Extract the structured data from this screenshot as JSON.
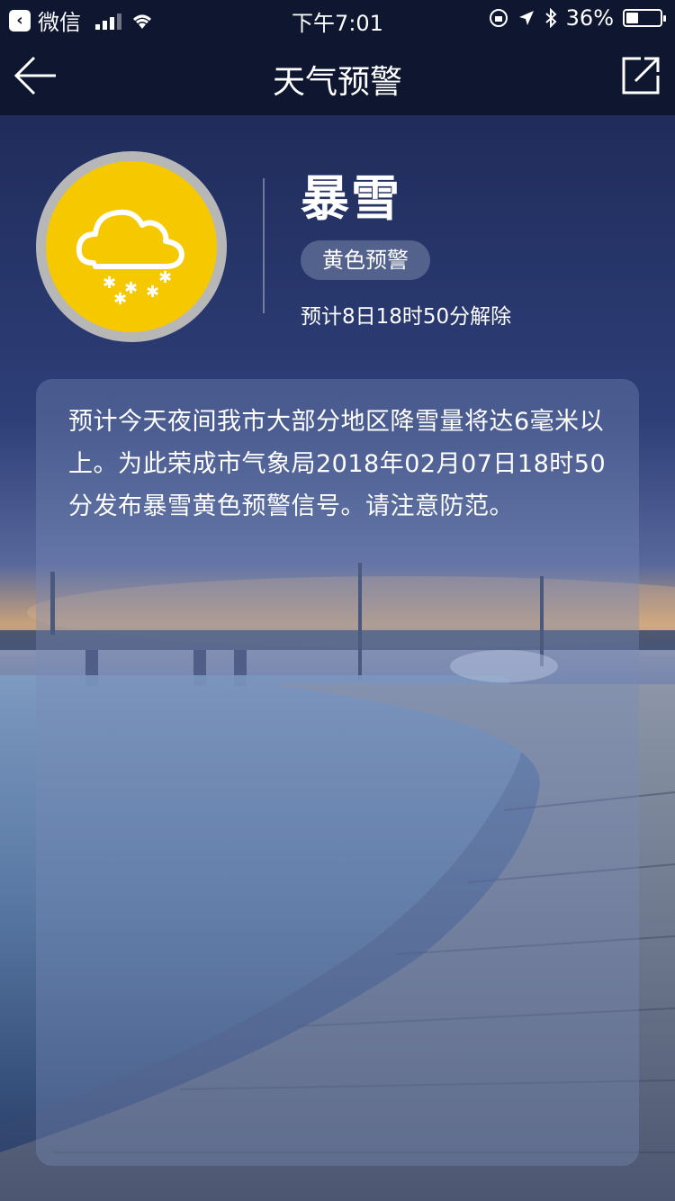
{
  "status_bar": {
    "back_app": "微信",
    "time": "下午7:01",
    "battery": "36%",
    "battery_level": 0.36
  },
  "nav": {
    "title": "天气预警",
    "back_icon": "arrow-left-icon",
    "share_icon": "share-icon"
  },
  "alert": {
    "type": "暴雪",
    "level": "黄色预警",
    "expiry": "预计8日18时50分解除",
    "icon": "snow-cloud-icon",
    "badge_color": "#f6c800"
  },
  "detail": {
    "text": "预计今天夜间我市大部分地区降雪量将达6毫米以上。为此荣成市气象局2018年02月07日18时50分发布暴雪黄色预警信号。请注意防范。"
  }
}
